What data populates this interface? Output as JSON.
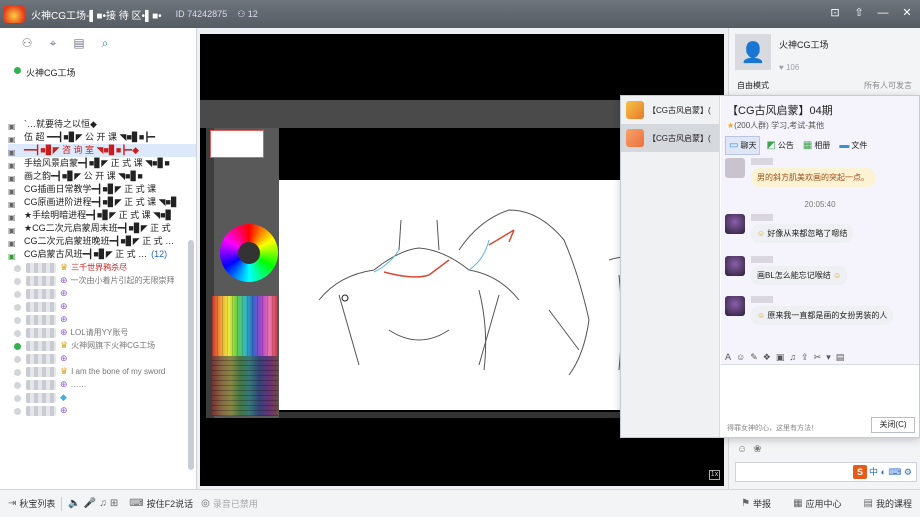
{
  "titlebar": {
    "title": "火神CG工场-▌■•接 待 区•▌■•",
    "id": "ID 74242875",
    "users": "12",
    "controls": [
      "⊡",
      "⇧",
      "—",
      "✕"
    ]
  },
  "left": {
    "root_channel": "火神CG工场",
    "channels": [
      {
        "label": "`…就要待之以恒◆",
        "style": ""
      },
      {
        "label": "伍 超 ━━┫■▊◤ 公  开  课 ◥■▊■┣━",
        "style": ""
      },
      {
        "label": "━━┫■▊◤ 咨  询  室 ◥■▊■┣━◆",
        "style": "red hl"
      },
      {
        "label": "手绘风景启蒙━┫■▊◤ 正  式  课 ◥■▊■",
        "style": ""
      },
      {
        "label": "画之韵━┫■▊◤ 公  开  课 ◥■▊■",
        "style": ""
      },
      {
        "label": "CG插画日常教学━┫■▊◤ 正  式  课",
        "style": ""
      },
      {
        "label": "CG原画进阶进程━┫■▊◤ 正 式 课 ◥■▊",
        "style": ""
      },
      {
        "label": "★手绘明暗进程━┫■▊◤ 正 式 课 ◥■▊",
        "style": ""
      },
      {
        "label": "★CG二次元启蒙周末班━┫■▊◤ 正  式",
        "style": ""
      },
      {
        "label": "CG二次元启蒙班晚班━┫■▊◤ 正  式  …",
        "style": ""
      },
      {
        "label": "CG启蒙古风班━┫■▊◤ 正  式  …",
        "style": "green-ch",
        "count": "(12)"
      }
    ],
    "users": [
      {
        "icon": "♛",
        "msg": "三千世界鸦杀尽",
        "msg_style": "red",
        "icon_style": "gold",
        "online": false
      },
      {
        "icon": "⊕",
        "msg": "一次由小着片引起的无限崇拜",
        "online": false
      },
      {
        "icon": "⊕",
        "msg": "",
        "online": false
      },
      {
        "icon": "⊕",
        "msg": "",
        "online": false
      },
      {
        "icon": "⊕",
        "msg": "",
        "online": false
      },
      {
        "icon": "⊕",
        "msg": "LOL请用YY账号",
        "online": false
      },
      {
        "icon": "♛",
        "msg": "火神网旗下火神CG工场",
        "icon_style": "gold",
        "online": true
      },
      {
        "icon": "⊕",
        "msg": "",
        "online": false
      },
      {
        "icon": "♛",
        "msg": "I am the bone of my sword",
        "icon_style": "gold",
        "online": false
      },
      {
        "icon": "⊕",
        "msg": "……",
        "online": false
      },
      {
        "icon": "◆",
        "msg": "",
        "icon_style": "blue",
        "online": false
      },
      {
        "icon": "⊕",
        "msg": "",
        "online": false
      }
    ]
  },
  "bottombar": {
    "reception_list": "秋宝列表",
    "press_f2": "按住F2说话",
    "recording_disabled": "录音已禁用",
    "report": "举报",
    "app_center": "应用中心",
    "my_courses": "我的课程"
  },
  "right": {
    "host_name": "火神CG工场",
    "likes": "106",
    "mode": "自由模式",
    "mode_desc": "所有人可发言"
  },
  "chatwin": {
    "list": [
      {
        "label": "【CG古风启蒙】("
      },
      {
        "label": "【CG古风启蒙】("
      }
    ],
    "title": "【CG古风启蒙】04期",
    "sub": "(200人群) 学习,考试-其他",
    "tabs": [
      "聊天",
      "公告",
      "相册",
      "文件"
    ],
    "messages": [
      {
        "text": "男的斜方肌美欢画的突起一点。"
      },
      {
        "text": "好像从来都忽略了嗯结"
      },
      {
        "text": "画BL怎么能忘记喉结"
      },
      {
        "text": "原来我一直都是画的女扮男装的人"
      }
    ],
    "time": "20:05:40",
    "placeholder": "得罪女神的心，这里有方法！",
    "close": "关闭(C)"
  }
}
